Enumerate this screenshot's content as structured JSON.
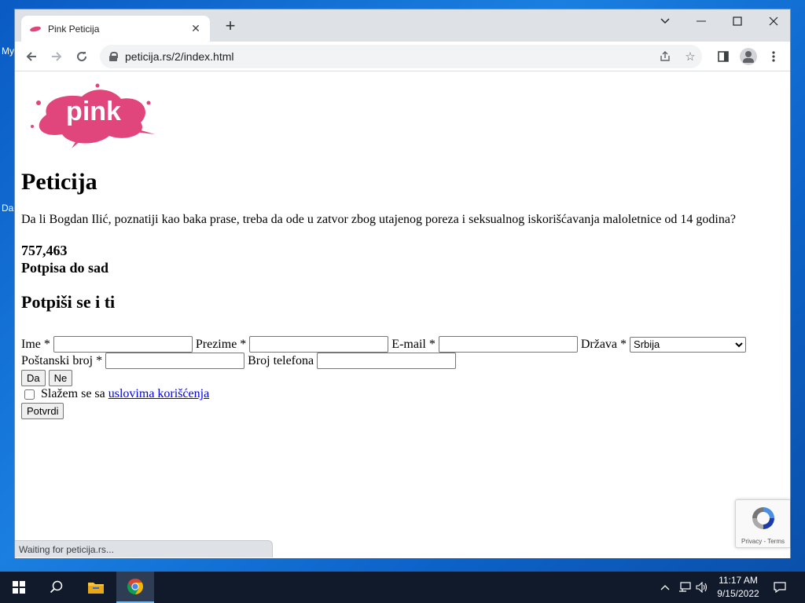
{
  "desktop": {
    "icon_label_1": "My",
    "icon_label_2": "Da"
  },
  "browser": {
    "tab_title": "Pink Peticija",
    "url": "peticija.rs/2/index.html",
    "status_text": "Waiting for peticija.rs..."
  },
  "page": {
    "logo_text": "pink",
    "heading": "Peticija",
    "question": "Da li Bogdan Ilić, poznatiji kao baka prase, treba da ode u zatvor zbog utajenog poreza i seksualnog iskorišćavanja maloletnice od 14 godina?",
    "signature_count": "757,463",
    "signature_label": "Potpisa do sad",
    "subheading": "Potpiši se i ti",
    "form": {
      "first_name_label": "Ime *",
      "last_name_label": "Prezime *",
      "email_label": "E-mail *",
      "country_label": "Država *",
      "country_selected": "Srbija",
      "postal_label": "Poštanski broj *",
      "phone_label": "Broj telefona",
      "yes_button": "Da",
      "no_button": "Ne",
      "agree_text": "Slažem se sa",
      "terms_link": "uslovima korišćenja",
      "submit_button": "Potvrdi"
    },
    "recaptcha_links": "Privacy - Terms"
  },
  "taskbar": {
    "time": "11:17 AM",
    "date": "9/15/2022"
  },
  "colors": {
    "brand_pink": "#e0457b",
    "link_blue": "#0000ee",
    "taskbar_bg": "#101a2a"
  }
}
